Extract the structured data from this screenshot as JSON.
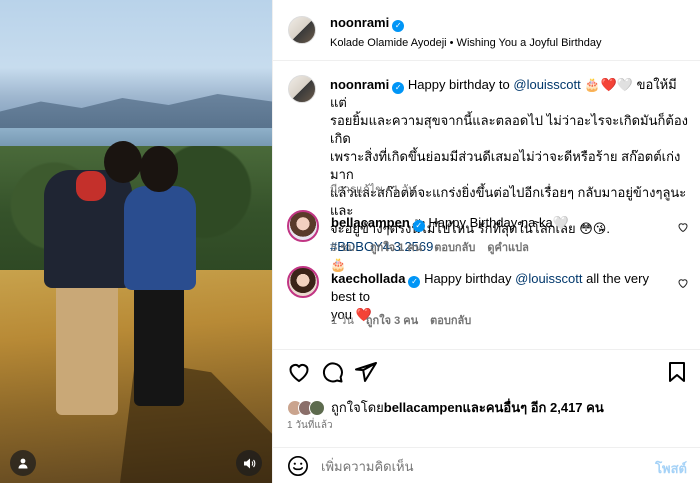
{
  "post": {
    "username": "noonrami",
    "subtitle": "Kolade Olamide Ayodeji • Wishing You a Joyful Birthday"
  },
  "caption": {
    "username": "noonrami",
    "text_1": "Happy birthday to ",
    "mention": "@louisscott",
    "emojis_1": "🎂❤️🤍",
    "text_2": " ขอให้มีแต่",
    "line_2": "รอยยิ้มและความสุขจากนี้และตลอดไป ไม่ว่าอะไรจะเกิดมันก็ต้องเกิด",
    "line_3": "เพราะสิ่งที่เกิดขึ้นย่อมมีส่วนดีเสมอไม่ว่าจะดีหรือร้าย สก๊อตต์เก่งมาก",
    "line_4": "แล้วและสก๊อตต์จะแกร่งยิ่งขึ้นต่อไปอีกเรื่อยๆ กลับมาอยู่ข้างๆลูนะและ",
    "line_5": "จะอยู่ข้างๆตรงนี้ไม่ไปไหน รักที่สุดในโลกเลย",
    "emojis_2": "😳😘",
    "hashtag": "#BDBOY4",
    "date": ".3.2569",
    "emoji_3": "🎂",
    "edited": "มีการแก้ไข",
    "time": "1 วัน"
  },
  "comments": [
    {
      "username": "bellacampen",
      "text": "Happy Birthday na ka",
      "emoji": "🤍",
      "time": "5 ชม.",
      "likes": "ถูกใจ 1 คน",
      "reply": "ตอบกลับ",
      "translate": "ดูคำแปล"
    },
    {
      "username": "kaechollada",
      "text": "Happy birthday ",
      "mention": "@louisscott",
      "text_2": " all the very best to",
      "text_3": "you ",
      "emoji": "❤️",
      "time": "1 วัน",
      "likes": "ถูกใจ 3 คน",
      "reply": "ตอบกลับ"
    }
  ],
  "likes": {
    "liked_by_prefix": "ถูกใจโดย ",
    "liked_by_user": "bellacampen",
    "others": " และคนอื่นๆ อีก 2,417 คน",
    "posted": "1 วันที่แล้ว"
  },
  "comment_box": {
    "placeholder": "เพิ่มความคิดเห็น",
    "post_label": "โพสต์"
  },
  "icons": {
    "heart": "heart-icon",
    "comment": "comment-icon",
    "share": "share-icon",
    "save": "bookmark-icon",
    "emoji": "emoji-icon",
    "tag": "user-tag-icon",
    "sound": "speaker-icon",
    "verified": "verified-badge-icon"
  },
  "colors": {
    "verified": "#0095f6",
    "link": "#00376b",
    "post_button": "#a5d2f7"
  }
}
